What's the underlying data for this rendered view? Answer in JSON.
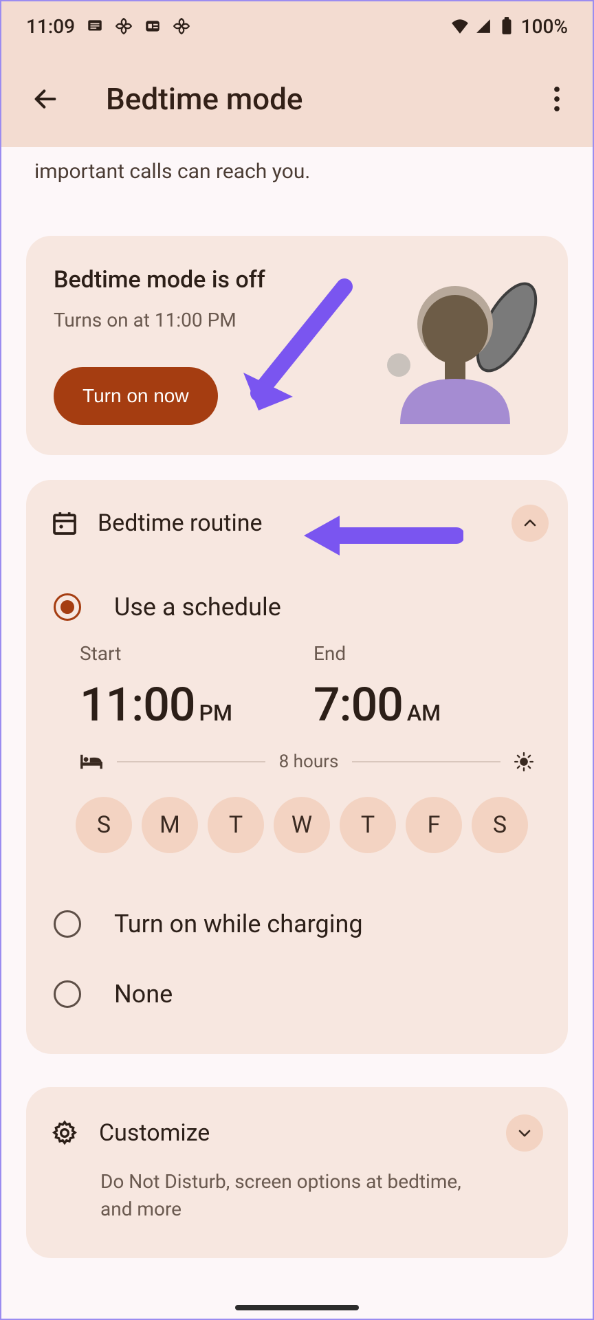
{
  "statusbar": {
    "time": "11:09",
    "battery": "100%"
  },
  "appbar": {
    "title": "Bedtime mode"
  },
  "intro": {
    "partial_text": "important calls can reach you."
  },
  "status_card": {
    "title": "Bedtime mode is off",
    "subtitle": "Turns on at 11:00 PM",
    "button_label": "Turn on now"
  },
  "routine": {
    "title": "Bedtime routine",
    "options": {
      "schedule": "Use a schedule",
      "charging": "Turn on while charging",
      "none": "None"
    },
    "start_label": "Start",
    "end_label": "End",
    "start_time": "11:00",
    "start_suffix": "PM",
    "end_time": "7:00",
    "end_suffix": "AM",
    "duration": "8 hours",
    "days": [
      "S",
      "M",
      "T",
      "W",
      "T",
      "F",
      "S"
    ]
  },
  "customize": {
    "title": "Customize",
    "subtitle": "Do Not Disturb, screen options at bedtime, and more"
  }
}
